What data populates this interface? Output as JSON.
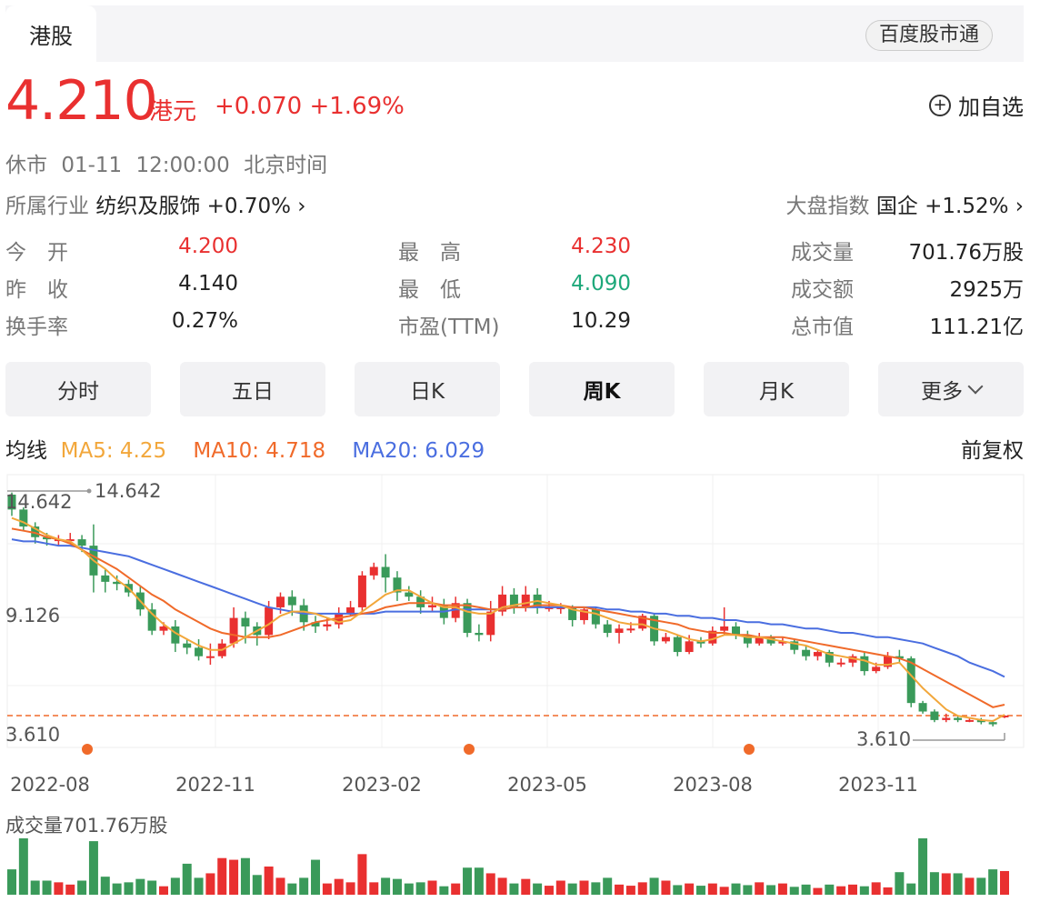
{
  "tabs": {
    "active": "港股"
  },
  "brand_button": "百度股市通",
  "quote": {
    "price": "4.210",
    "unit": "港元",
    "change": "+0.070",
    "change_pct": "+1.69%",
    "add_favorite": "加自选",
    "status": "休市",
    "time": "01-11 12:00:00",
    "timezone": "北京时间"
  },
  "industry": {
    "label": "所属行业",
    "name": "纺织及服饰",
    "change": "+0.70%"
  },
  "market_index": {
    "label": "大盘指数",
    "name": "国企",
    "change": "+1.52%"
  },
  "stats": [
    {
      "label": "今　开",
      "value": "4.200",
      "color": "red"
    },
    {
      "label": "最　高",
      "value": "4.230",
      "color": "red"
    },
    {
      "label": "成交量",
      "value": "701.76万股",
      "color": "dark"
    },
    {
      "label": "昨　收",
      "value": "4.140",
      "color": "dark"
    },
    {
      "label": "最　低",
      "value": "4.090",
      "color": "green"
    },
    {
      "label": "成交额",
      "value": "2925万",
      "color": "dark"
    },
    {
      "label": "换手率",
      "value": "0.27%",
      "color": "dark"
    },
    {
      "label": "市盈(TTM)",
      "value": "10.29",
      "color": "dark"
    },
    {
      "label": "总市值",
      "value": "111.21亿",
      "color": "dark"
    }
  ],
  "periods": [
    "分时",
    "五日",
    "日K",
    "周K",
    "月K",
    "更多"
  ],
  "active_period": "周K",
  "ma": {
    "label": "均线",
    "ma5": "MA5: 4.25",
    "ma10": "MA10: 4.718",
    "ma20": "MA20: 6.029",
    "adjust": "前复权"
  },
  "colors": {
    "up": "#e93030",
    "down": "#3a9a5a",
    "ma5": "#f2a73b",
    "ma10": "#f06a2a",
    "ma20": "#4a6ee0"
  },
  "chart_data": {
    "type": "candlestick",
    "y_labels": [
      "14.642",
      "9.126",
      "3.610"
    ],
    "ylim": [
      3.61,
      14.642
    ],
    "max_marker": "14.642",
    "min_marker": "3.610",
    "x_labels": [
      "2022-08",
      "2022-11",
      "2023-02",
      "2023-05",
      "2023-08",
      "2023-11"
    ],
    "candles": [
      [
        14.6,
        13.9,
        14.7,
        13.6
      ],
      [
        13.9,
        13.1,
        14.0,
        12.9
      ],
      [
        13.1,
        12.6,
        13.3,
        12.3
      ],
      [
        12.6,
        12.5,
        12.8,
        12.2
      ],
      [
        12.5,
        12.5,
        12.7,
        12.2
      ],
      [
        12.5,
        12.5,
        12.8,
        12.3
      ],
      [
        12.5,
        12.2,
        12.7,
        11.9
      ],
      [
        12.2,
        10.8,
        13.2,
        10.0
      ],
      [
        10.8,
        10.5,
        11.1,
        10.0
      ],
      [
        10.5,
        10.4,
        10.8,
        10.1
      ],
      [
        10.4,
        10.0,
        10.6,
        9.8
      ],
      [
        10.0,
        9.2,
        10.3,
        8.9
      ],
      [
        9.2,
        8.2,
        9.5,
        8.0
      ],
      [
        8.2,
        8.4,
        8.6,
        8.0
      ],
      [
        8.4,
        7.6,
        8.7,
        7.2
      ],
      [
        7.6,
        7.4,
        7.8,
        7.1
      ],
      [
        7.4,
        7.0,
        7.8,
        6.8
      ],
      [
        7.0,
        7.0,
        7.6,
        6.6
      ],
      [
        7.0,
        7.6,
        7.8,
        6.9
      ],
      [
        7.6,
        8.8,
        9.3,
        7.4
      ],
      [
        8.8,
        8.4,
        9.1,
        7.6
      ],
      [
        8.4,
        8.0,
        8.6,
        7.5
      ],
      [
        8.0,
        9.3,
        9.6,
        7.8
      ],
      [
        9.3,
        9.8,
        10.0,
        9.0
      ],
      [
        9.8,
        9.4,
        10.1,
        8.9
      ],
      [
        9.4,
        8.6,
        9.7,
        8.2
      ],
      [
        8.6,
        8.4,
        8.9,
        8.1
      ],
      [
        8.4,
        8.5,
        8.8,
        8.2
      ],
      [
        8.5,
        9.0,
        9.3,
        8.3
      ],
      [
        9.0,
        9.3,
        9.6,
        8.9
      ],
      [
        9.3,
        10.8,
        11.0,
        9.1
      ],
      [
        10.8,
        11.2,
        11.4,
        10.6
      ],
      [
        11.2,
        10.7,
        11.8,
        10.0
      ],
      [
        10.7,
        10.0,
        11.0,
        9.6
      ],
      [
        10.0,
        9.8,
        10.3,
        9.6
      ],
      [
        9.8,
        9.3,
        10.1,
        9.0
      ],
      [
        9.3,
        9.4,
        9.8,
        9.1
      ],
      [
        9.4,
        8.8,
        9.7,
        8.5
      ],
      [
        8.8,
        9.5,
        9.8,
        8.6
      ],
      [
        9.5,
        8.1,
        9.7,
        7.9
      ],
      [
        8.1,
        8.0,
        8.5,
        7.7
      ],
      [
        8.0,
        9.1,
        9.6,
        7.7
      ],
      [
        9.1,
        9.9,
        10.3,
        8.9
      ],
      [
        9.9,
        9.3,
        10.2,
        9.0
      ],
      [
        9.3,
        9.9,
        10.3,
        9.1
      ],
      [
        9.9,
        9.3,
        10.2,
        9.0
      ],
      [
        9.3,
        9.3,
        9.6,
        9.1
      ],
      [
        9.3,
        9.3,
        9.5,
        9.0
      ],
      [
        9.3,
        8.7,
        9.4,
        8.4
      ],
      [
        8.7,
        9.2,
        9.3,
        8.5
      ],
      [
        9.2,
        8.5,
        9.3,
        8.3
      ],
      [
        8.5,
        8.1,
        8.7,
        7.9
      ],
      [
        8.1,
        8.3,
        8.5,
        7.6
      ],
      [
        8.3,
        8.3,
        8.6,
        8.1
      ],
      [
        8.3,
        8.9,
        9.0,
        8.2
      ],
      [
        8.9,
        7.7,
        9.0,
        7.5
      ],
      [
        7.7,
        7.9,
        8.1,
        7.6
      ],
      [
        7.9,
        7.2,
        8.0,
        7.0
      ],
      [
        7.2,
        7.7,
        8.0,
        7.1
      ],
      [
        7.7,
        7.6,
        7.9,
        7.4
      ],
      [
        7.6,
        8.2,
        8.4,
        7.5
      ],
      [
        8.2,
        8.4,
        9.3,
        8.0
      ],
      [
        8.4,
        8.0,
        8.6,
        7.8
      ],
      [
        8.0,
        7.6,
        8.2,
        7.4
      ],
      [
        7.6,
        7.9,
        8.1,
        7.5
      ],
      [
        7.9,
        7.6,
        8.0,
        7.5
      ],
      [
        7.6,
        7.7,
        7.9,
        7.5
      ],
      [
        7.7,
        7.3,
        7.8,
        7.1
      ],
      [
        7.3,
        7.0,
        7.5,
        6.8
      ],
      [
        7.0,
        7.2,
        7.3,
        6.8
      ],
      [
        7.2,
        6.7,
        7.3,
        6.5
      ],
      [
        6.7,
        6.7,
        6.9,
        6.5
      ],
      [
        6.7,
        7.0,
        7.1,
        6.5
      ],
      [
        7.0,
        6.3,
        7.2,
        6.1
      ],
      [
        6.3,
        6.5,
        6.7,
        6.2
      ],
      [
        6.5,
        7.0,
        7.2,
        6.4
      ],
      [
        7.0,
        6.9,
        7.3,
        6.7
      ],
      [
        6.9,
        4.8,
        7.0,
        4.6
      ],
      [
        4.8,
        4.4,
        4.9,
        4.3
      ],
      [
        4.4,
        4.0,
        4.5,
        3.9
      ],
      [
        4.0,
        4.1,
        4.3,
        3.9
      ],
      [
        4.1,
        4.0,
        4.2,
        3.9
      ],
      [
        4.0,
        4.0,
        4.1,
        3.9
      ],
      [
        4.0,
        3.9,
        4.1,
        3.8
      ],
      [
        3.9,
        3.8,
        4.0,
        3.7
      ],
      [
        4.14,
        4.21,
        4.23,
        4.09
      ]
    ],
    "ma5": [
      13.5,
      13.3,
      13.0,
      12.7,
      12.5,
      12.4,
      12.0,
      11.5,
      11.1,
      10.6,
      10.2,
      9.6,
      9.0,
      8.5,
      8.1,
      7.8,
      7.5,
      7.3,
      7.3,
      7.6,
      7.9,
      8.2,
      8.5,
      8.9,
      9.1,
      9.1,
      9.0,
      8.8,
      8.6,
      8.7,
      9.1,
      9.5,
      9.9,
      10.1,
      10.1,
      9.8,
      9.5,
      9.3,
      9.3,
      9.1,
      9.0,
      9.0,
      9.3,
      9.4,
      9.5,
      9.6,
      9.5,
      9.4,
      9.2,
      9.1,
      9.0,
      8.8,
      8.6,
      8.5,
      8.5,
      8.3,
      8.2,
      8.0,
      7.8,
      7.7,
      7.8,
      8.0,
      8.0,
      7.9,
      7.9,
      7.8,
      7.7,
      7.6,
      7.5,
      7.3,
      7.1,
      7.0,
      6.9,
      6.8,
      6.6,
      6.6,
      6.7,
      6.1,
      5.5,
      5.0,
      4.5,
      4.2,
      4.1,
      4.0,
      3.95,
      4.25
    ],
    "ma10": [
      13.0,
      12.9,
      12.8,
      12.6,
      12.5,
      12.3,
      12.0,
      11.7,
      11.4,
      11.1,
      10.7,
      10.3,
      9.9,
      9.6,
      9.2,
      8.9,
      8.6,
      8.3,
      8.1,
      8.0,
      7.9,
      7.9,
      7.9,
      8.0,
      8.2,
      8.4,
      8.6,
      8.7,
      8.8,
      8.9,
      9.0,
      9.1,
      9.3,
      9.4,
      9.5,
      9.5,
      9.5,
      9.4,
      9.4,
      9.4,
      9.3,
      9.2,
      9.2,
      9.3,
      9.3,
      9.4,
      9.4,
      9.4,
      9.3,
      9.3,
      9.2,
      9.1,
      9.0,
      8.9,
      8.8,
      8.7,
      8.6,
      8.5,
      8.3,
      8.2,
      8.1,
      8.1,
      8.0,
      8.0,
      7.9,
      7.9,
      7.9,
      7.8,
      7.7,
      7.6,
      7.5,
      7.4,
      7.3,
      7.2,
      7.1,
      7.0,
      6.9,
      6.7,
      6.4,
      6.1,
      5.8,
      5.5,
      5.2,
      4.9,
      4.6,
      4.72
    ],
    "ma20": [
      12.5,
      12.4,
      12.4,
      12.3,
      12.2,
      12.2,
      12.1,
      12.0,
      11.9,
      11.8,
      11.7,
      11.5,
      11.3,
      11.1,
      10.9,
      10.7,
      10.5,
      10.3,
      10.1,
      9.9,
      9.7,
      9.5,
      9.3,
      9.2,
      9.1,
      9.0,
      9.0,
      9.0,
      9.0,
      9.0,
      9.0,
      9.0,
      9.1,
      9.1,
      9.1,
      9.1,
      9.1,
      9.1,
      9.2,
      9.2,
      9.2,
      9.2,
      9.2,
      9.3,
      9.3,
      9.3,
      9.3,
      9.3,
      9.3,
      9.3,
      9.3,
      9.2,
      9.2,
      9.1,
      9.1,
      9.0,
      9.0,
      8.9,
      8.9,
      8.8,
      8.8,
      8.7,
      8.7,
      8.6,
      8.6,
      8.5,
      8.5,
      8.4,
      8.3,
      8.3,
      8.2,
      8.1,
      8.1,
      8.0,
      7.9,
      7.9,
      7.8,
      7.7,
      7.6,
      7.4,
      7.2,
      7.0,
      6.7,
      6.5,
      6.3,
      6.03
    ],
    "volume_label": "成交量701.76万股",
    "volume": [
      0.45,
      1.0,
      0.25,
      0.25,
      0.22,
      0.18,
      0.25,
      0.95,
      0.32,
      0.2,
      0.22,
      0.28,
      0.25,
      0.15,
      0.3,
      0.55,
      0.3,
      0.38,
      0.65,
      0.62,
      0.65,
      0.35,
      0.5,
      0.3,
      0.2,
      0.3,
      0.62,
      0.2,
      0.28,
      0.22,
      0.72,
      0.22,
      0.3,
      0.28,
      0.2,
      0.22,
      0.25,
      0.15,
      0.2,
      0.48,
      0.48,
      0.38,
      0.3,
      0.2,
      0.28,
      0.2,
      0.16,
      0.25,
      0.2,
      0.25,
      0.22,
      0.3,
      0.18,
      0.16,
      0.22,
      0.3,
      0.25,
      0.17,
      0.2,
      0.16,
      0.2,
      0.14,
      0.2,
      0.17,
      0.22,
      0.17,
      0.2,
      0.14,
      0.18,
      0.12,
      0.18,
      0.15,
      0.18,
      0.15,
      0.22,
      0.13,
      0.4,
      0.2,
      1.0,
      0.4,
      0.38,
      0.38,
      0.3,
      0.3,
      0.45,
      0.42
    ]
  }
}
